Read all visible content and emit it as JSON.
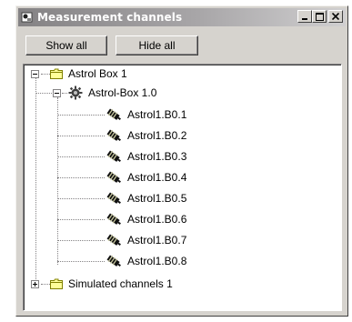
{
  "window": {
    "title": "Measurement channels"
  },
  "toolbar": {
    "show_all_label": "Show all",
    "hide_all_label": "Hide all"
  },
  "tree": {
    "root1": {
      "label": "Astrol Box 1",
      "child": {
        "label": "Astrol-Box 1.0",
        "channels": [
          "Astrol1.B0.1",
          "Astrol1.B0.2",
          "Astrol1.B0.3",
          "Astrol1.B0.4",
          "Astrol1.B0.5",
          "Astrol1.B0.6",
          "Astrol1.B0.7",
          "Astrol1.B0.8"
        ]
      }
    },
    "root2": {
      "label": "Simulated channels 1"
    }
  },
  "icons": {
    "app": "app-icon",
    "folder": "folder-icon",
    "device": "device-gear-icon",
    "channel": "sensor-channel-icon"
  },
  "colors": {
    "folder": "#ffff99",
    "folder_outline": "#808000"
  }
}
